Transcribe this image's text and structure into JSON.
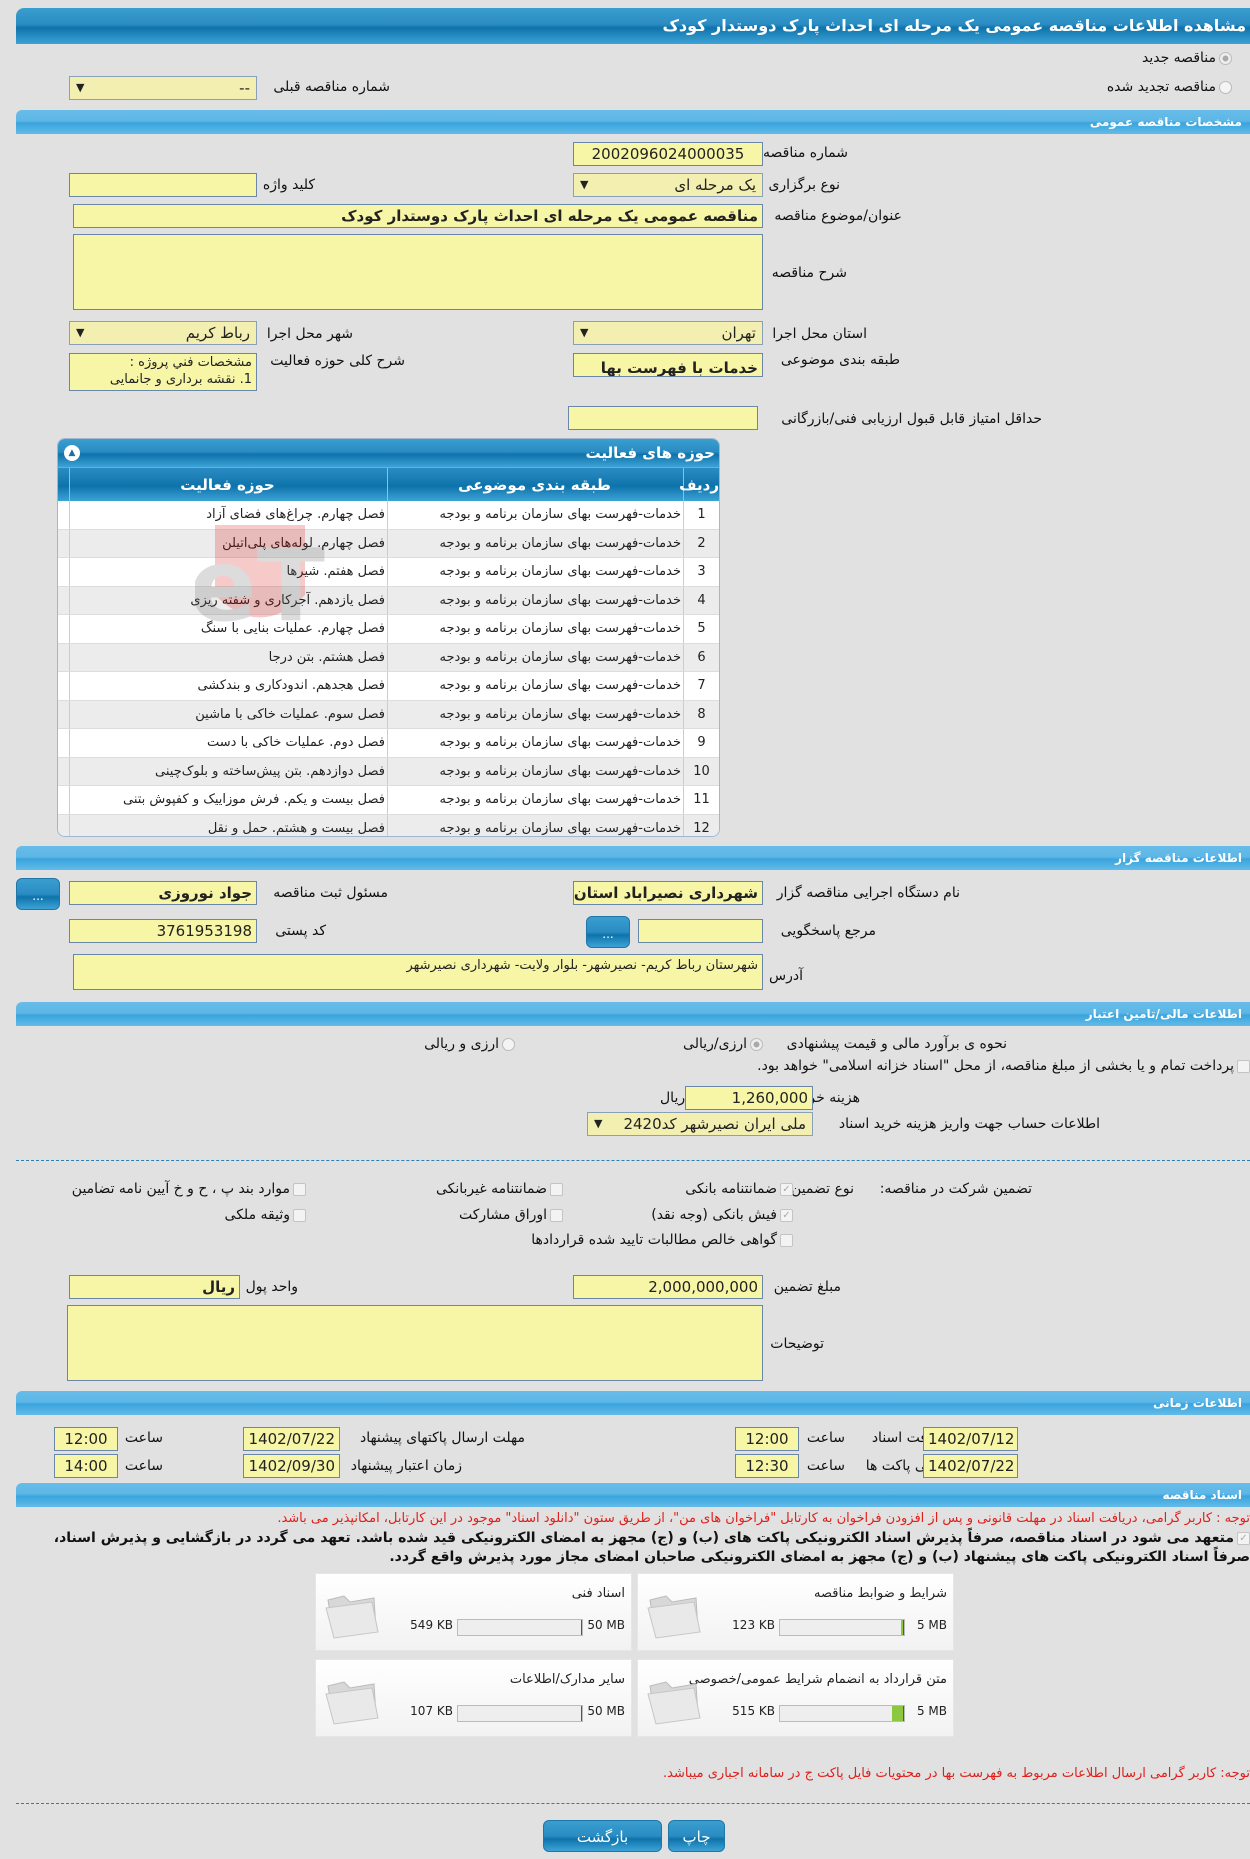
{
  "header": {
    "title": "مشاهده اطلاعات مناقصه عمومی یک مرحله ای احداث پارک دوستدار کودک"
  },
  "tender_type": {
    "new_label": "مناقصه جدید",
    "renewed_label": "مناقصه تجدید شده",
    "previous_label": "شماره مناقصه قبلی",
    "previous_value": "--"
  },
  "general": {
    "section_title": "مشخصات مناقصه عمومی",
    "number_label": "شماره مناقصه",
    "number_value": "2002096024000035",
    "holding_type_label": "نوع برگزاری",
    "holding_type_value": "یک مرحله ای",
    "keyword_label": "کلید واژه",
    "keyword_value": "",
    "title_label": "عنوان/موضوع مناقصه",
    "title_value": "مناقصه عمومی یک مرحله ای احداث پارک دوستدار کودک",
    "description_label": "شرح مناقصه",
    "description_value": "",
    "province_label": "استان محل اجرا",
    "province_value": "تهران",
    "city_label": "شهر محل اجرا",
    "city_value": "رباط کریم",
    "category_label": "طبقه بندی موضوعی",
    "category_value": "خدمات با فهرست بها",
    "scope_label": "شرح کلی حوزه فعالیت",
    "scope_line1": "مشخصات فني پروژه :",
    "scope_line2": "1.    نقشه برداری و جانمایی",
    "min_score_label": "حداقل امتیاز قابل قبول ارزیابی فنی/بازرگانی",
    "min_score_value": ""
  },
  "activities": {
    "title": "حوزه های فعالیت",
    "columns": [
      "ردیف",
      "طبقه بندی موضوعی",
      "حوزه فعالیت"
    ],
    "rows": [
      {
        "n": "1",
        "cat": "خدمات-فهرست بهای سازمان برنامه و بودجه",
        "act": "فصل چهارم. چراغ‌های فضای آزاد"
      },
      {
        "n": "2",
        "cat": "خدمات-فهرست بهای سازمان برنامه و بودجه",
        "act": "فصل چهارم. لوله‌های پلی‌اتیلن"
      },
      {
        "n": "3",
        "cat": "خدمات-فهرست بهای سازمان برنامه و بودجه",
        "act": "فصل هفتم. شیرها"
      },
      {
        "n": "4",
        "cat": "خدمات-فهرست بهای سازمان برنامه و بودجه",
        "act": "فصل یازدهم. آجرکاری و شفته ریزی"
      },
      {
        "n": "5",
        "cat": "خدمات-فهرست بهای سازمان برنامه و بودجه",
        "act": "فصل چهارم. عملیات بنایی با سنگ"
      },
      {
        "n": "6",
        "cat": "خدمات-فهرست بهای سازمان برنامه و بودجه",
        "act": "فصل هشتم. بتن درجا"
      },
      {
        "n": "7",
        "cat": "خدمات-فهرست بهای سازمان برنامه و بودجه",
        "act": "فصل هجدهم. اندودکاری و بندکشی"
      },
      {
        "n": "8",
        "cat": "خدمات-فهرست بهای سازمان برنامه و بودجه",
        "act": "فصل سوم. عملیات خاکی با ماشین"
      },
      {
        "n": "9",
        "cat": "خدمات-فهرست بهای سازمان برنامه و بودجه",
        "act": "فصل دوم. عملیات خاکی با دست"
      },
      {
        "n": "10",
        "cat": "خدمات-فهرست بهای سازمان برنامه و بودجه",
        "act": "فصل دوازدهم. بتن پیش‌ساخته و بلوک‌چینی"
      },
      {
        "n": "11",
        "cat": "خدمات-فهرست بهای سازمان برنامه و بودجه",
        "act": "فصل بیست و یکم. فرش موزاییک و کفپوش بتنی"
      },
      {
        "n": "12",
        "cat": "خدمات-فهرست بهای سازمان برنامه و بودجه",
        "act": "فصل بیست و هشتم. حمل و نقل"
      }
    ]
  },
  "organizer": {
    "section_title": "اطلاعات مناقصه گزار",
    "agency_label": "نام دستگاه اجرایی مناقصه گزار",
    "agency_value": "شهرداری نصیراباد استان تهران",
    "registrar_label": "مسئول ثبت مناقصه",
    "registrar_value": "جواد نوروزی",
    "reference_label": "مرجع پاسخگویی",
    "reference_value": "",
    "postal_label": "کد پستی",
    "postal_value": "3761953198",
    "address_label": "آدرس",
    "address_value": "شهرستان رباط کریم- نصیرشهر- بلوار ولایت- شهرداری نصیرشهر",
    "dots": "..."
  },
  "finance": {
    "section_title": "اطلاعات مالی/تامین اعتبار",
    "estimate_label": "نحوه ی برآورد مالی و قیمت پیشنهادی",
    "opt1": "ارزی/ریالی",
    "opt2": "ارزی و ریالی",
    "treasury_label": "پرداخت تمام و یا بخشی از مبلغ مناقصه، از محل \"اسناد خزانه اسلامی\" خواهد بود.",
    "doc_cost_label": "هزینه خرید اسناد",
    "doc_cost_value": "1,260,000",
    "doc_cost_unit": "ریال",
    "bank_label": "اطلاعات حساب جهت واریز هزینه خرید اسناد",
    "bank_value": "ملی ایران نصیرشهر کد2420"
  },
  "guarantee": {
    "label": "تضمین شرکت در مناقصه:",
    "type_label": "نوع تضمین",
    "options": [
      {
        "label": "ضمانتنامه بانکی",
        "checked": true
      },
      {
        "label": "ضمانتنامه غیربانکی",
        "checked": false
      },
      {
        "label": "موارد بند پ ، ح و خ آیین نامه تضامین",
        "checked": false
      },
      {
        "label": "فیش بانکی (وجه نقد)",
        "checked": true
      },
      {
        "label": "اوراق مشارکت",
        "checked": false
      },
      {
        "label": "وثیقه ملکی",
        "checked": false
      },
      {
        "label": "گواهی خالص مطالبات تایید شده قراردادها",
        "checked": false
      }
    ],
    "amount_label": "مبلغ تضمین",
    "amount_value": "2,000,000,000",
    "currency_label": "واحد پول",
    "currency_value": "ریال",
    "notes_label": "توضیحات",
    "notes_value": ""
  },
  "timing": {
    "section_title": "اطلاعات زمانی",
    "hour_label": "ساعت",
    "doc_deadline_label": "مهلت دریافت اسناد",
    "doc_deadline_date": "1402/07/12",
    "doc_deadline_time": "12:00",
    "submit_deadline_label": "مهلت ارسال پاکتهای پیشنهاد",
    "submit_deadline_date": "1402/07/22",
    "submit_deadline_time": "12:00",
    "opening_label": "زمان بازگشایی پاکت ها",
    "opening_date": "1402/07/22",
    "opening_time": "12:30",
    "validity_label": "زمان اعتبار پیشنهاد",
    "validity_date": "1402/09/30",
    "validity_time": "14:00"
  },
  "documents": {
    "section_title": "اسناد مناقصه",
    "notice": "توجه : کاربر گرامی، دریافت اسناد در مهلت قانونی و پس از افزودن فراخوان به کارتابل \"فراخوان های من\"، از طریق ستون \"دانلود اسناد\" موجود در این کارتابل، امکانپذیر می باشد.",
    "commit_line1": "متعهد می شود در اسناد مناقصه، صرفاً پذیرش اسناد الکترونیکی پاکت های (ب) و (ج) مجهز به امضای الکترونیکی قید شده باشد. تعهد می گردد در بازگشایی و پذیرش اسناد،",
    "commit_line2": "صرفاً اسناد الکترونیکی پاکت های پیشنهاد (ب) و (ج) مجهز به امضای الکترونیکی صاحبان امضای مجاز مورد پذیرش واقع گردد.",
    "files": [
      {
        "name": "شرایط و ضوابط مناقصه",
        "size": "123 KB",
        "max": "5 MB",
        "fill": 0.024
      },
      {
        "name": "اسناد فنی",
        "size": "549 KB",
        "max": "50 MB",
        "fill": 0.011
      },
      {
        "name": "متن قرارداد به انضمام شرایط عمومی/خصوصی",
        "size": "515 KB",
        "max": "5 MB",
        "fill": 0.1
      },
      {
        "name": "سایر مدارک/اطلاعات",
        "size": "107 KB",
        "max": "50 MB",
        "fill": 0.002
      }
    ],
    "price_notice": "توجه: کاربر گرامی ارسال اطلاعات مربوط به فهرست بها در محتویات فایل پاکت ج در سامانه اجباری میباشد."
  },
  "actions": {
    "back": "بازگشت",
    "print": "چاپ"
  },
  "watermark": "AriaTender.neT"
}
